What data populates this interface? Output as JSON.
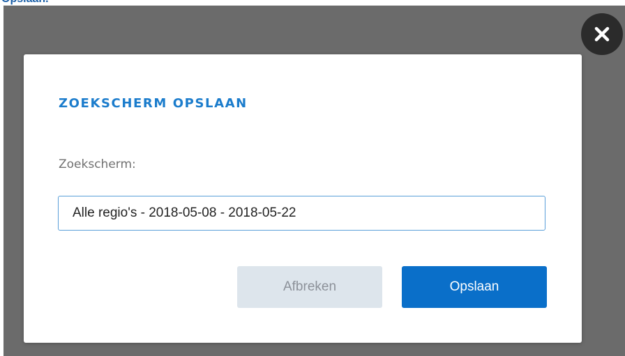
{
  "background": {
    "partial_heading": "Opslaan."
  },
  "dialog": {
    "title": "ZOEKSCHERM OPSLAAN",
    "field_label": "Zoekscherm:",
    "input_value": "Alle regio's - 2018-05-08 - 2018-05-22",
    "cancel_label": "Afbreken",
    "save_label": "Opslaan",
    "close_icon": "close-icon"
  },
  "colors": {
    "overlay": "#6b6b6b",
    "title": "#1b7ccc",
    "primary_button": "#0a6fc9",
    "secondary_button": "#dde5ec",
    "input_border": "#5a9fd9",
    "close_button": "#2b2b2b"
  }
}
